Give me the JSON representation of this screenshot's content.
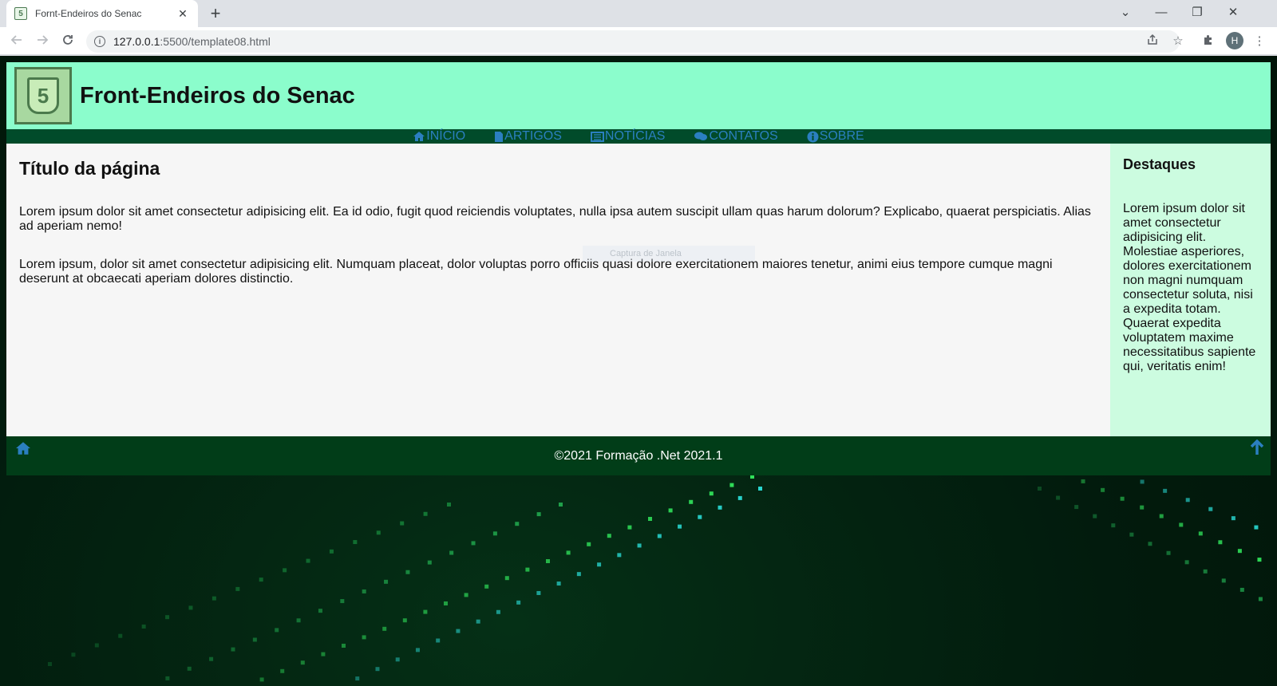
{
  "browser": {
    "tab_title": "Fornt-Endeiros do Senac",
    "tab_close": "✕",
    "new_tab": "+",
    "url_host": "127.0.0.1",
    "url_path": ":5500/template08.html",
    "profile_initial": "H",
    "window_controls": [
      "⌄",
      "—",
      "❐",
      "✕"
    ]
  },
  "header": {
    "logo_glyph": "5",
    "title": "Front-Endeiros do Senac"
  },
  "nav": {
    "items": [
      {
        "icon": "home-icon",
        "label": "INÍCIO"
      },
      {
        "icon": "file-icon",
        "label": "ARTIGOS"
      },
      {
        "icon": "newspaper-icon",
        "label": "NOTÍCIAS"
      },
      {
        "icon": "comments-icon",
        "label": "CONTATOS"
      },
      {
        "icon": "info-circle-icon",
        "label": "SOBRE"
      }
    ]
  },
  "main": {
    "title": "Título da página",
    "paragraphs": [
      "Lorem ipsum dolor sit amet consectetur adipisicing elit. Ea id odio, fugit quod reiciendis voluptates, nulla ipsa autem suscipit ullam quas harum dolorum? Explicabo, quaerat perspiciatis. Alias ad aperiam nemo!",
      "Lorem ipsum, dolor sit amet consectetur adipisicing elit. Numquam placeat, dolor voluptas porro officiis quasi dolore exercitationem maiores tenetur, animi eius tempore cumque magni deserunt at obcaecati aperiam dolores distinctio."
    ],
    "overlay_text": "Captura de Janela"
  },
  "aside": {
    "title": "Destaques",
    "text": "Lorem ipsum dolor sit amet consectetur adipisicing elit. Molestiae asperiores, dolores exercitationem non magni numquam consectetur soluta, nisi a expedita totam. Quaerat expedita voluptatem maxime necessitatibus sapiente qui, veritatis enim!"
  },
  "footer": {
    "text": "©2021 Formação .Net 2021.1",
    "home_icon": "home-icon",
    "up_icon": "arrow-up-icon"
  },
  "colors": {
    "header_bg": "#8bfdcc",
    "nav_bg": "#014b2a",
    "nav_link": "#2b7fc0",
    "aside_bg": "#ccfce0",
    "footer_bg": "#013d18"
  }
}
